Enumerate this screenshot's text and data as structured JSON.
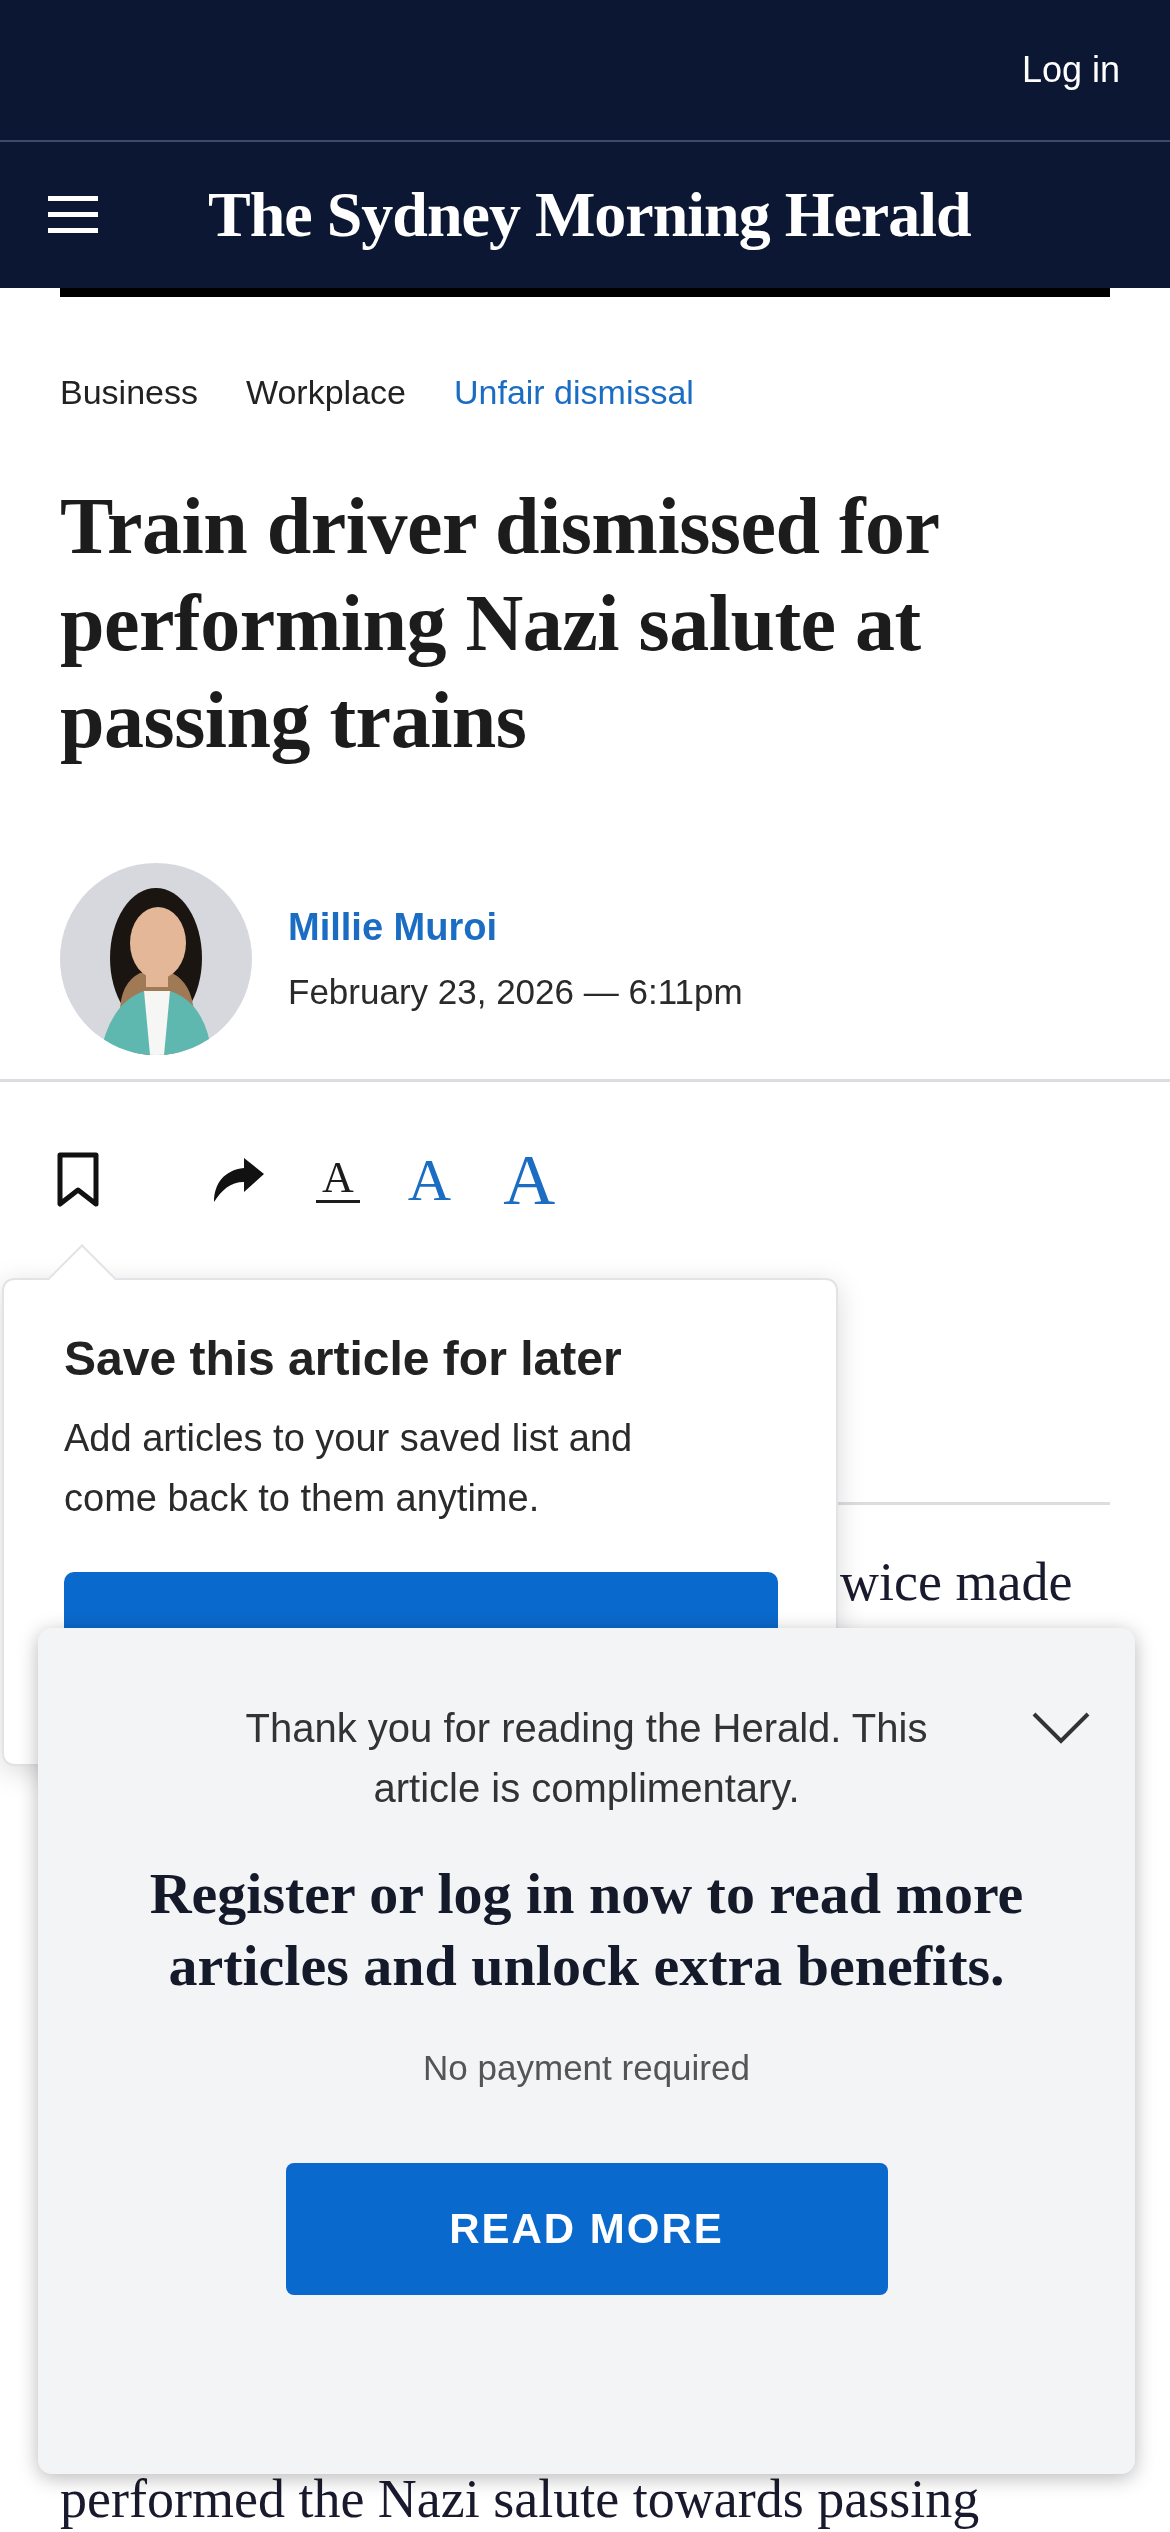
{
  "header": {
    "login": "Log in",
    "logo": "The Sydney Morning Herald"
  },
  "breadcrumbs": [
    {
      "label": "Business",
      "selected": false
    },
    {
      "label": "Workplace",
      "selected": false
    },
    {
      "label": "Unfair dismissal",
      "selected": true
    }
  ],
  "headline": "Train driver dismissed for performing Nazi salute at passing trains",
  "byline": {
    "author": "Millie Muroi",
    "date": "February 23, 2026 — 6:11pm"
  },
  "font_sizes": [
    {
      "label": "A",
      "selected": true
    },
    {
      "label": "A",
      "selected": false
    },
    {
      "label": "A",
      "selected": false
    }
  ],
  "save_popover": {
    "title": "Save this article for later",
    "text": "Add articles to your saved list and come back to them anytime."
  },
  "article": {
    "lines": [
      "wice made",
      "performed the Nazi salute towards passing"
    ]
  },
  "paywall": {
    "intro": "Thank you for reading the Herald. This article is complimentary.",
    "headline": "Register or log in now to read more articles and unlock extra benefits.",
    "note": "No payment required",
    "button": "READ MORE"
  }
}
